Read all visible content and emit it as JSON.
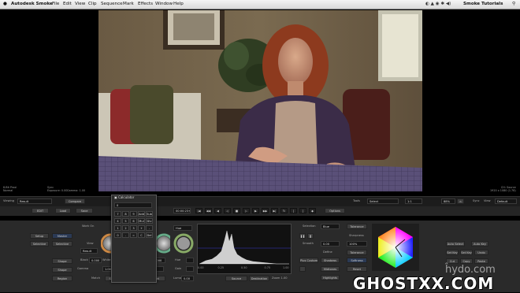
{
  "menubar": {
    "app_name": "Autodesk Smoke",
    "menus": [
      "File",
      "Edit",
      "View",
      "Clip",
      "Sequence",
      "Mark",
      "Effects",
      "Window",
      "Help"
    ],
    "right_label": "Smoke Tutorials"
  },
  "viewer": {
    "left_info_1": "8-Bit Proxi",
    "left_info_2": "Normal",
    "left_info_3": "Sync",
    "left_info_4": "Exposure: 0.00",
    "left_info_5": "Gamma: 1.00",
    "right_info_1": "CH: Source",
    "right_info_2": "1920 x 1080 (1.78)"
  },
  "toolbar1": {
    "viewing_label": "Viewing",
    "viewing_value": "Result",
    "compare_label": "Compare",
    "tools_label": "Tools",
    "tools_value": "Select",
    "zoom_value": "88%",
    "sync_label": "Sync",
    "view_label": "View",
    "default_label": "Default"
  },
  "toolbar2": {
    "edit_label": "EDIT",
    "load_label": "Load",
    "save_label": "Save",
    "timecode_start": "00:00:23+01",
    "options_label": "Options"
  },
  "calculator": {
    "title": "Calculator",
    "keys": [
      "7",
      "8",
      "9",
      "Add",
      "Sub",
      "4",
      "5",
      "6",
      "Mul",
      "Div",
      "1",
      "2",
      "3",
      "+",
      "-",
      "0",
      ".",
      "=",
      "C",
      "Del"
    ]
  },
  "panel": {
    "setup_label": "Setup",
    "selective_label": "Selective",
    "work_on_label": "Work On",
    "master_label": "Master",
    "view_label": "View",
    "result_label": "Result",
    "black_label": "Black",
    "black_value": "0.000",
    "white_label": "White",
    "white_value": "1.000",
    "gamma_label": "Gamma",
    "gamma_value": "1.000",
    "sat_label": "Sat",
    "sat_value": "1.000",
    "match_label": "Match",
    "select_label": "Select",
    "pick_label": "Pick",
    "set_label": "Set",
    "luma_label": "Luma",
    "luma_value": "0.00",
    "shape_label": "Shape",
    "region_label": "Region",
    "histo_ticks": [
      "0.00",
      "0.25",
      "0.50",
      "0.75",
      "1.00"
    ],
    "source_label": "Source",
    "destination_label": "Destination",
    "zoom_label": "Zoom",
    "zoom_value": "1.00",
    "selection_label": "Selection",
    "selection_value": "Blue",
    "smooth_label": "Smooth",
    "smooth_value": "0.00",
    "percent_value": "100%",
    "tolerance_label": "Tolerance",
    "sharpness_label": "Sharpness",
    "softness_label": "Softness",
    "define_label": "Define",
    "plus_custom_label": "Plus Custom",
    "shadows_label": "Shadows",
    "midtones_label": "Midtones",
    "highlights_label": "Highlights",
    "reset_label": "Reset",
    "auto_select_label": "Auto Select",
    "auto_key_label": "Auto Key",
    "set_key_label": "Set Key",
    "undo_label": "Undo",
    "cut_label": "Cut",
    "copy_label": "Copy",
    "paste_label": "Paste"
  },
  "watermark": {
    "line1": "ĥydo.com",
    "line2": "GHOSTXX.COM"
  },
  "colors": {
    "panel_bg": "#2a2a2a",
    "menubar_bg": "#e6e6e6",
    "accent_blue": "#2b3a55",
    "watermark": "#ffffff"
  }
}
